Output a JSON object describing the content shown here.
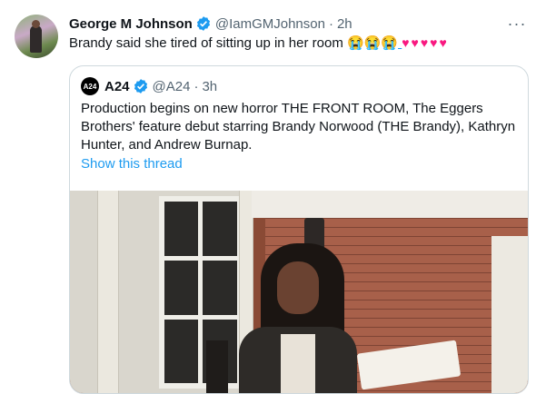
{
  "tweet": {
    "author_name": "George M Johnson",
    "author_handle": "@IamGMJohnson",
    "separator": "·",
    "time": "2h",
    "more_label": "···",
    "text": "Brandy said she tired of sitting up in her room",
    "emojis": [
      "😭",
      "😭",
      "😭"
    ],
    "hearts": [
      "♥",
      "♥",
      "♥",
      "♥",
      "♥"
    ]
  },
  "quote": {
    "logo_text": "A24",
    "author_name": "A24",
    "author_handle": "@A24",
    "separator": "·",
    "time": "3h",
    "text": "Production begins on new horror THE FRONT ROOM, The Eggers Brothers' feature debut starring Brandy Norwood (THE Brandy), Kathryn Hunter, and Andrew Burnap.",
    "show_thread": "Show this thread"
  },
  "colors": {
    "verified": "#1d9bf0",
    "link": "#1d9bf0",
    "muted": "#536471",
    "heart": "#f91880"
  }
}
